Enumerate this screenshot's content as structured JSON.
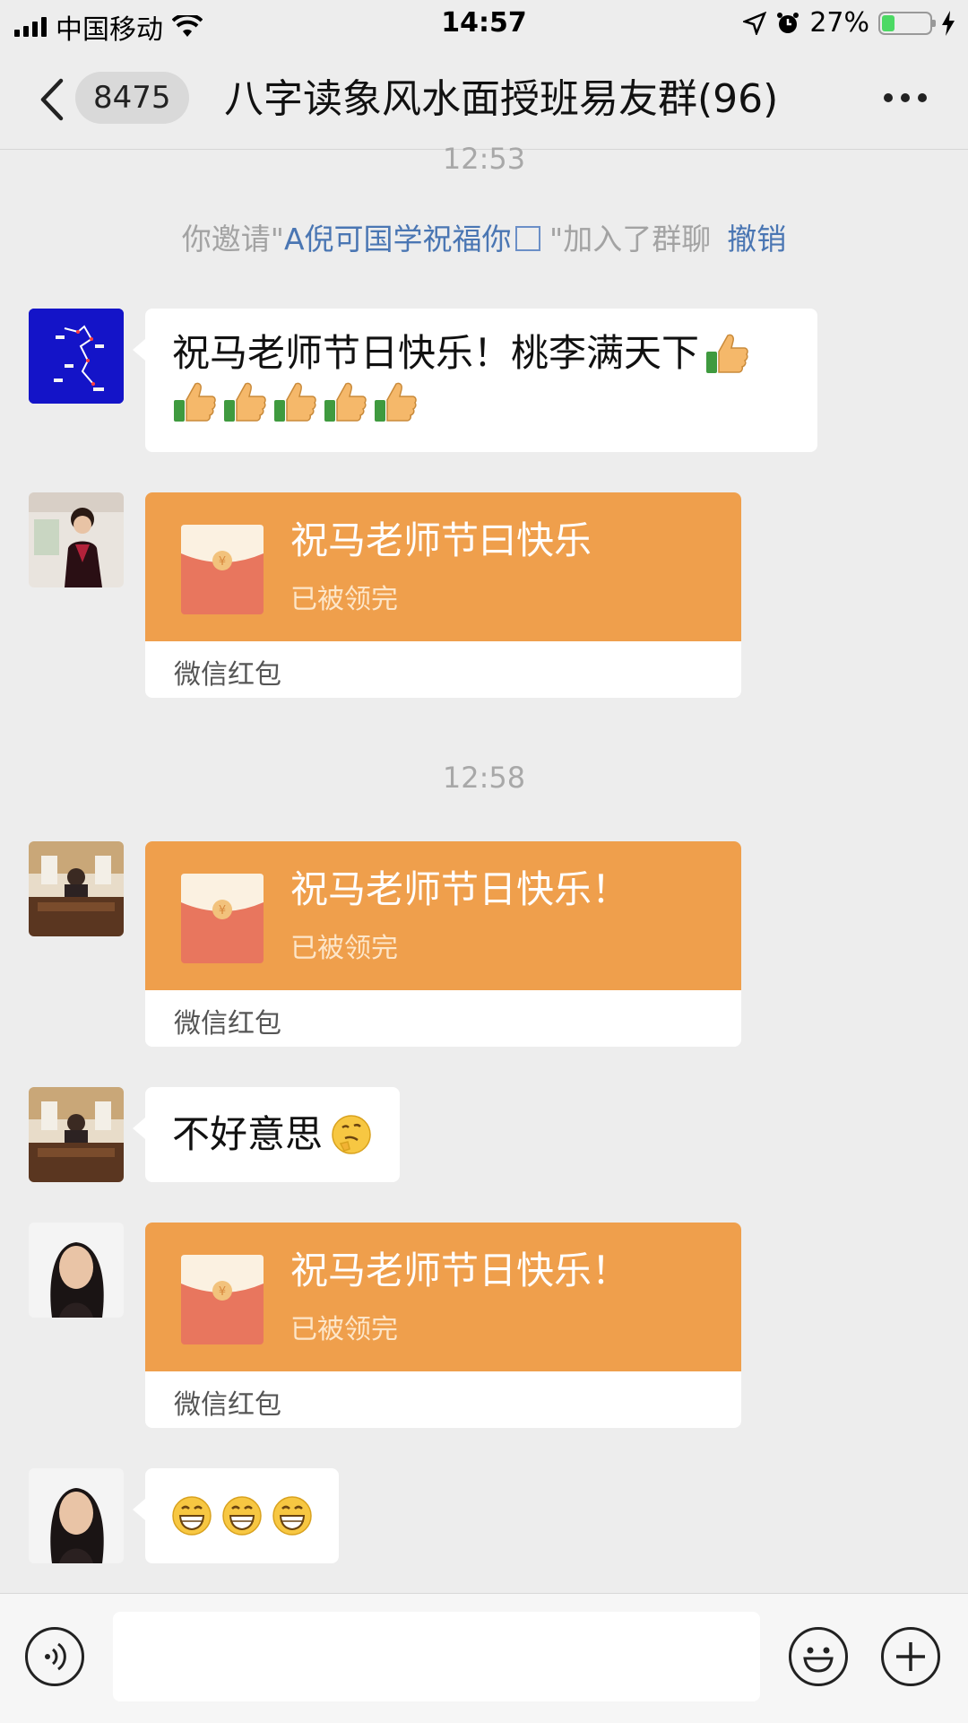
{
  "status_bar": {
    "carrier": "中国移动",
    "time": "14:57",
    "battery": "27%"
  },
  "nav": {
    "back_badge": "8475",
    "title": "八字读象风水面授班易友群(96)"
  },
  "timestamps": [
    "12:53",
    "12:58"
  ],
  "system_message": {
    "prefix": "你邀请\"",
    "name": "A倪可国学祝福你",
    "suffix": " \"加入了群聊",
    "action": "撤销"
  },
  "messages": [
    {
      "type": "text",
      "text": "祝马老师节日快乐！桃李满天下",
      "emoji": "thumbs-up",
      "emoji_count": 6
    },
    {
      "type": "red_packet",
      "title": "祝马老师节曰快乐",
      "status": "已被领完",
      "footer": "微信红包"
    },
    {
      "type": "red_packet",
      "title": "祝马老师节日快乐！",
      "status": "已被领完",
      "footer": "微信红包"
    },
    {
      "type": "text",
      "text": "不好意思",
      "emoji": "thinking-face"
    },
    {
      "type": "red_packet",
      "title": "祝马老师节日快乐！",
      "status": "已被领完",
      "footer": "微信红包"
    },
    {
      "type": "emoji",
      "emoji": "grinning-face",
      "emoji_count": 3
    }
  ],
  "colors": {
    "red_packet": "#ef9f4c",
    "link": "#4a76b3",
    "background": "#ededed"
  },
  "input_bar": {
    "placeholder": "",
    "icons": [
      "voice-icon",
      "emoji-icon",
      "plus-icon"
    ]
  }
}
